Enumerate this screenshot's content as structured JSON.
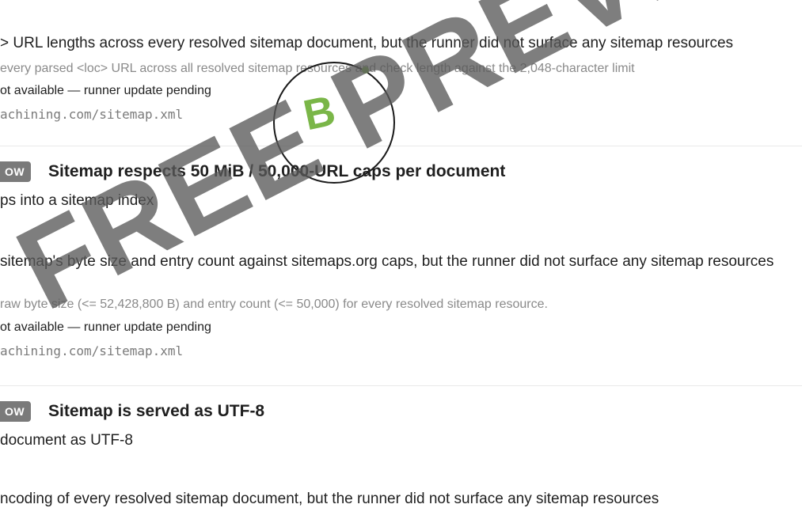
{
  "item1": {
    "description": "> URL lengths across every resolved sitemap document, but the runner did not surface any sitemap resources",
    "hint": " every parsed <loc> URL across all resolved sitemap resources and check length against the 2,048-character limit",
    "status": "ot available — runner update pending",
    "url": "achining.com/sitemap.xml"
  },
  "grade": {
    "letter": "B"
  },
  "item2": {
    "badge": "OW",
    "title": "Sitemap respects 50 MiB / 50,000-URL caps per document",
    "subtitle": "ps into a sitemap index",
    "description": " sitemap's byte size and entry count against sitemaps.org caps, but the runner did not surface any sitemap resources",
    "hint": " raw byte size (<= 52,428,800 B) and entry count (<= 50,000) for every resolved sitemap resource.",
    "status": "ot available — runner update pending",
    "url": "achining.com/sitemap.xml"
  },
  "item3": {
    "badge": "OW",
    "title": "Sitemap is served as UTF-8",
    "subtitle": "document as UTF-8",
    "description": "ncoding of every resolved sitemap document, but the runner did not surface any sitemap resources"
  },
  "watermark": {
    "text": "FREE PREVIEW"
  }
}
